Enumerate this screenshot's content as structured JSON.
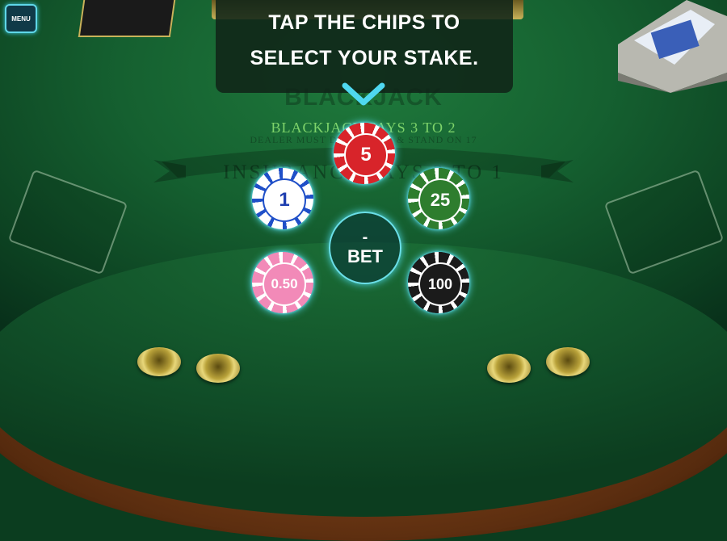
{
  "menu": {
    "label": "MENU"
  },
  "tooltip": {
    "line1": "TAP THE CHIPS TO",
    "line2": "SELECT YOUR STAKE."
  },
  "felt": {
    "logo": "BLACKJACK",
    "line1": "BLACKJACK PAYS 3 TO 2",
    "line2": "DEALER MUST DRAW TO 16 & STAND ON 17",
    "line3": "INSURANCE PAYS 2 TO 1"
  },
  "chips": [
    {
      "value": "5",
      "color": "#d8242a",
      "accent": "#ffffff",
      "text_color": "#ffffff"
    },
    {
      "value": "1",
      "color": "#ffffff",
      "accent": "#1f4fc8",
      "text_color": "#1f3fb0"
    },
    {
      "value": "25",
      "color": "#2e7d2e",
      "accent": "#ffffff",
      "text_color": "#ffffff"
    },
    {
      "value": "0.50",
      "color": "#f28ab8",
      "accent": "#ffffff",
      "text_color": "#ffffff"
    },
    {
      "value": "100",
      "color": "#1b1b1b",
      "accent": "#ffffff",
      "text_color": "#ffffff"
    }
  ],
  "bet": {
    "amount": "-",
    "label": "BET"
  },
  "colors": {
    "felt": "#156030",
    "highlight": "#5fe6ff",
    "rail": "#6e3814"
  }
}
